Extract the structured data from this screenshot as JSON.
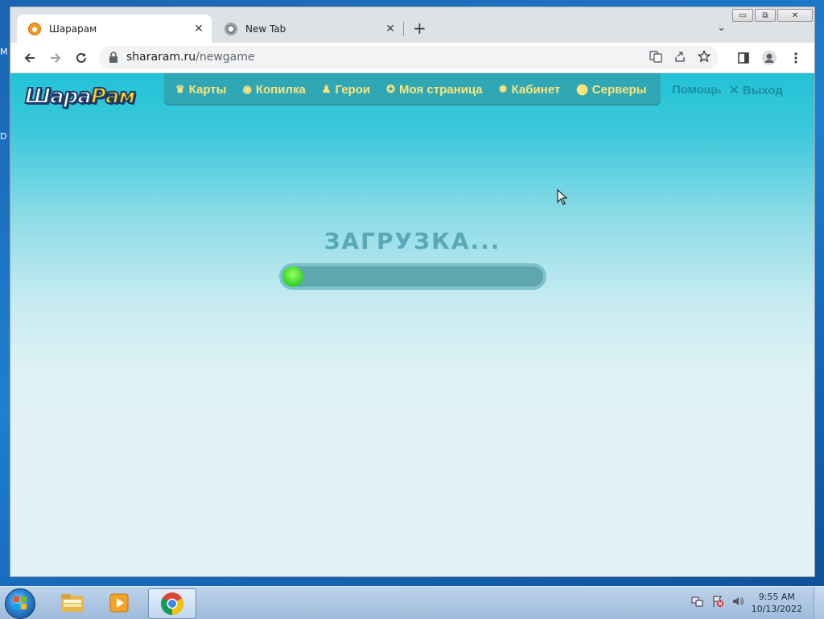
{
  "desktop": {
    "labels": [
      "M",
      "D"
    ]
  },
  "browser": {
    "window_controls": {
      "minimize": "▭",
      "restore": "⧉",
      "close": "✕"
    },
    "tabs": [
      {
        "title": "Шарарам",
        "close": "✕",
        "active": true
      },
      {
        "title": "New Tab",
        "close": "✕",
        "active": false
      }
    ],
    "new_tab": "+",
    "tab_menu": "⌄",
    "url_host": "shararam.ru",
    "url_path": "/newgame"
  },
  "site": {
    "logo_part1": "Шара",
    "logo_part2": "Рам",
    "nav": [
      {
        "icon": "♛",
        "label": "Карты"
      },
      {
        "icon": "◉",
        "label": "Копилка"
      },
      {
        "icon": "♟",
        "label": "Герои"
      },
      {
        "icon": "✪",
        "label": "Моя страница"
      },
      {
        "icon": "✹",
        "label": "Кабинет"
      },
      {
        "icon": "⬤",
        "label": "Серверы"
      }
    ],
    "help": "Помощь",
    "logout_icon": "✕",
    "logout": "Выход",
    "loading_text": "ЗАГРУЗКА...",
    "loading_progress": 0.08
  },
  "taskbar": {
    "time": "9:55 AM",
    "date": "10/13/2022"
  },
  "colors": {
    "nav_bg": "#2fa7b5",
    "nav_text": "#fde47a",
    "progress_fill": "#3fd92a"
  }
}
